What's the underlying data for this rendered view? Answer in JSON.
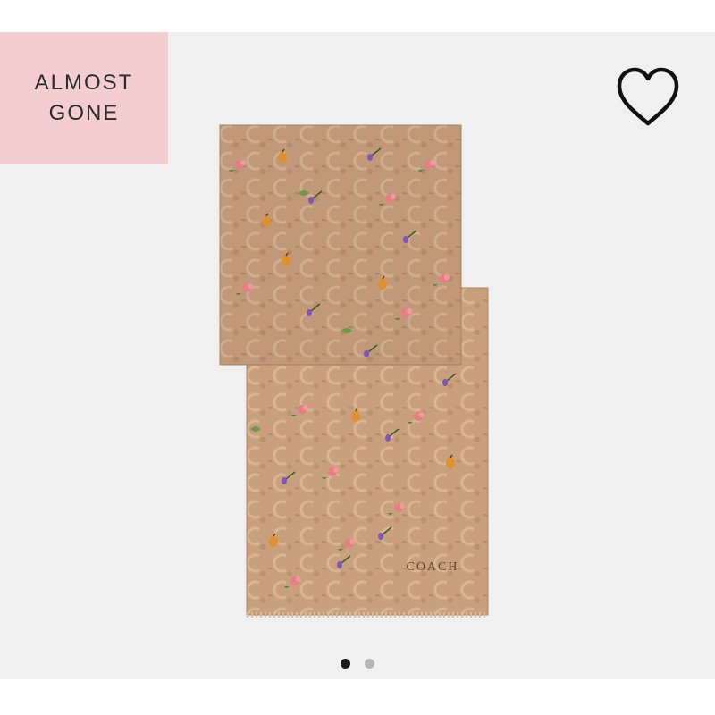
{
  "badge": {
    "line1": "ALMOST",
    "line2": "GONE",
    "bg_color": "#f3cdd0"
  },
  "wishlist": {
    "icon": "heart-outline-icon"
  },
  "product": {
    "image": "scarf-signature-floral-print",
    "brand_mark": "COACH",
    "fabric_color": "#c9a07e"
  },
  "carousel": {
    "total": 2,
    "active_index": 0
  }
}
